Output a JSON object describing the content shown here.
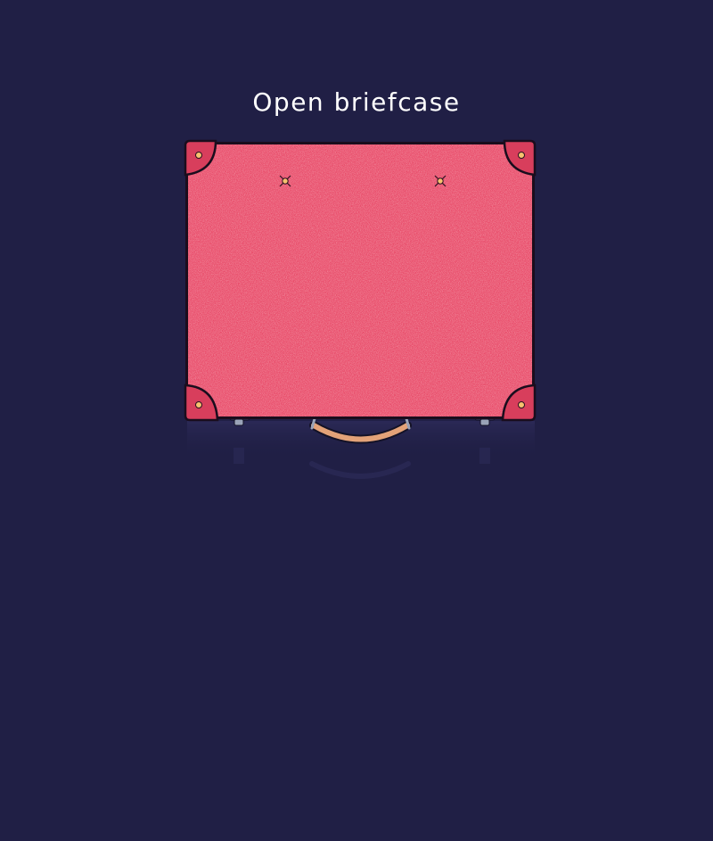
{
  "page": {
    "title": "Open briefcase"
  },
  "briefcase": {
    "state": "closed",
    "colors": {
      "background": "#201f45",
      "body": "#e84a68",
      "outline": "#1a0d1d",
      "corner": "#d83e5c",
      "rivet": "#f7c26f",
      "handle": "#e3a278",
      "hinge": "#8a93a8",
      "reflection": "#2a2852"
    }
  }
}
